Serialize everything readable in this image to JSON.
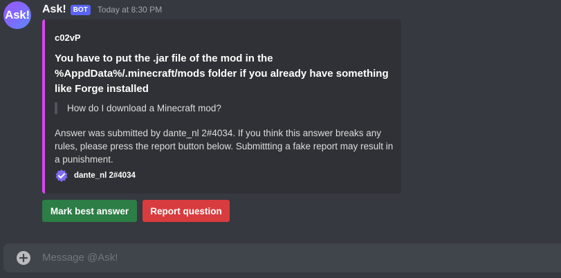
{
  "message": {
    "avatar_text": "Ask!",
    "username": "Ask!",
    "bot_badge": "BOT",
    "timestamp": "Today at 8:30 PM"
  },
  "embed": {
    "accent_color": "#d946ef",
    "author": "c02vP",
    "title": "You have to put the .jar file of the mod in the %AppdData%/.minecraft/mods folder if you already have something like Forge installed",
    "quote": "How do I download a Minecraft mod?",
    "description": "Answer was submitted by dante_nl 2#4034. If you think this answer breaks any rules, please press the report button below. Submittting a fake report may result in a punishment.",
    "footer_icon": "verified-check-icon",
    "footer_text": "dante_nl 2#4034"
  },
  "buttons": {
    "mark_best": "Mark best answer",
    "mark_best_color": "#2d7d46",
    "report": "Report question",
    "report_color": "#d83c3e"
  },
  "composer": {
    "add_icon": "plus-circle-icon",
    "placeholder": "Message @Ask!"
  }
}
